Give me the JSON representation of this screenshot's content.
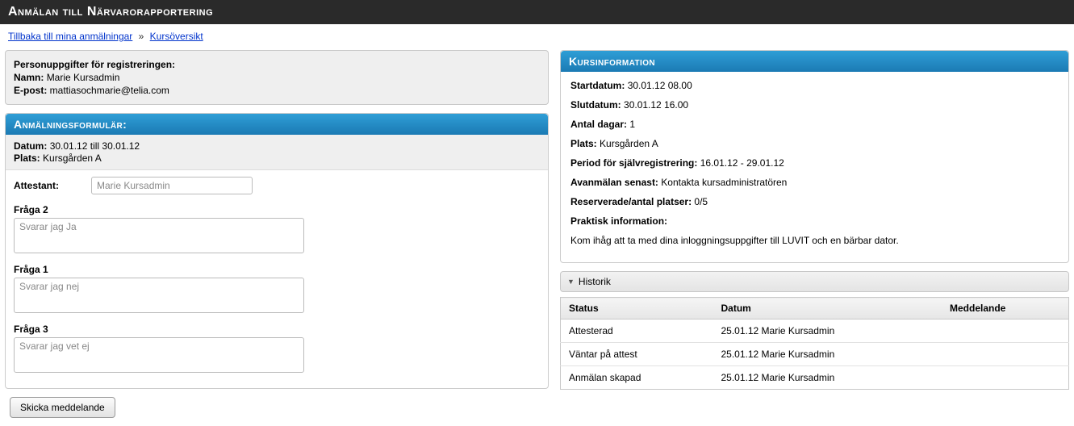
{
  "header": {
    "title": "Anmälan till Närvarorapportering"
  },
  "breadcrumb": {
    "back": "Tillbaka till mina anmälningar",
    "sep": "»",
    "current": "Kursöversikt"
  },
  "person": {
    "heading": "Personuppgifter för registreringen:",
    "name_label": "Namn:",
    "name_value": "Marie Kursadmin",
    "email_label": "E-post:",
    "email_value": "mattiasochmarie@telia.com"
  },
  "form": {
    "heading": "Anmälningsformulär:",
    "datum_label": "Datum:",
    "datum_value": "30.01.12 till 30.01.12",
    "plats_label": "Plats:",
    "plats_value": "Kursgården A",
    "attestant_label": "Attestant:",
    "attestant_value": "Marie Kursadmin",
    "q2_label": "Fråga 2",
    "q2_value": "Svarar jag Ja",
    "q1_label": "Fråga 1",
    "q1_value": "Svarar jag nej",
    "q3_label": "Fråga 3",
    "q3_value": "Svarar jag vet ej"
  },
  "button": {
    "send": "Skicka meddelande"
  },
  "course": {
    "heading": "Kursinformation",
    "start_label": "Startdatum:",
    "start_value": "30.01.12 08.00",
    "end_label": "Slutdatum:",
    "end_value": "30.01.12 16.00",
    "days_label": "Antal dagar:",
    "days_value": "1",
    "place_label": "Plats:",
    "place_value": "Kursgården A",
    "selfreg_label": "Period för självregistrering:",
    "selfreg_value": "16.01.12 - 29.01.12",
    "cancel_label": "Avanmälan senast:",
    "cancel_value": "Kontakta kursadministratören",
    "seats_label": "Reserverade/antal platser:",
    "seats_value": "0/5",
    "practical_label": "Praktisk information:",
    "practical_text": "Kom ihåg att ta med dina inloggningsuppgifter till LUVIT och en bärbar dator."
  },
  "history": {
    "heading": "Historik",
    "cols": {
      "status": "Status",
      "date": "Datum",
      "msg": "Meddelande"
    },
    "rows": [
      {
        "status": "Attesterad",
        "date": "25.01.12 Marie Kursadmin",
        "msg": ""
      },
      {
        "status": "Väntar på attest",
        "date": "25.01.12 Marie Kursadmin",
        "msg": ""
      },
      {
        "status": "Anmälan skapad",
        "date": "25.01.12 Marie Kursadmin",
        "msg": ""
      }
    ]
  }
}
